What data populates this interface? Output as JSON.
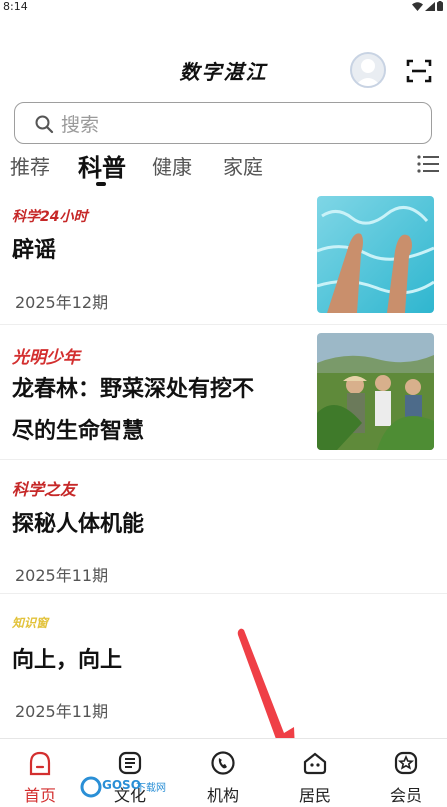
{
  "status_bar": {
    "time": "8:14"
  },
  "header": {
    "app_title": "数字湛江"
  },
  "search": {
    "placeholder": "搜索"
  },
  "tabs": [
    {
      "label": "推荐"
    },
    {
      "label": "科普"
    },
    {
      "label": "健康"
    },
    {
      "label": "家庭"
    }
  ],
  "active_tab": "科普",
  "articles": [
    {
      "publication": "科学24小时",
      "title": "辟谣",
      "issue": "2025年12期",
      "thumbnail": "feet-in-pool-photo"
    },
    {
      "publication": "光明少年",
      "title": "龙春林：野菜深处有挖不尽的生命智慧",
      "title_line1": "龙春林：野菜深处有挖不",
      "title_line2": "尽的生命智慧",
      "thumbnail": "researchers-in-field-photo"
    },
    {
      "publication": "科学之友",
      "title": "探秘人体机能",
      "issue": "2025年11期"
    },
    {
      "publication": "知识窗",
      "title": "向上，向上",
      "issue": "2025年11期"
    }
  ],
  "bottom_nav": [
    {
      "label": "首页",
      "icon": "home-icon",
      "active": true
    },
    {
      "label": "文化",
      "icon": "culture-icon"
    },
    {
      "label": "机构",
      "icon": "phone-icon"
    },
    {
      "label": "居民",
      "icon": "residents-icon"
    },
    {
      "label": "会员",
      "icon": "member-icon"
    }
  ],
  "watermark": {
    "text": "GOSO",
    "subtext": "下载网"
  },
  "colors": {
    "accent": "#d32f2f",
    "arrow": "#ef3f46"
  }
}
